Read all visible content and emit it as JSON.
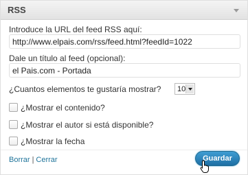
{
  "widget": {
    "title": "RSS",
    "toggle_icon": "triangle-down-icon"
  },
  "form": {
    "url_label": "Introduce la URL del feed RSS aquí:",
    "url_value": "http://www.elpais.com/rss/feed.html?feedId=1022",
    "title_label": "Dale un título al feed (opcional):",
    "title_value": "el Pais.com - Portada",
    "count_label": "¿Cuantos elementos te gustaría mostrar?",
    "count_value": "10",
    "options": [
      {
        "label": "¿Mostrar el contenido?",
        "checked": false
      },
      {
        "label": "¿Mostrar el autor si está disponible?",
        "checked": false
      },
      {
        "label": "¿Mostrar la fecha",
        "checked": false
      }
    ]
  },
  "footer": {
    "delete_label": "Borrar",
    "separator": "|",
    "close_label": "Cerrar",
    "save_label": "Guardar"
  },
  "colors": {
    "link": "#21759b",
    "button": "#1e6fa4"
  }
}
